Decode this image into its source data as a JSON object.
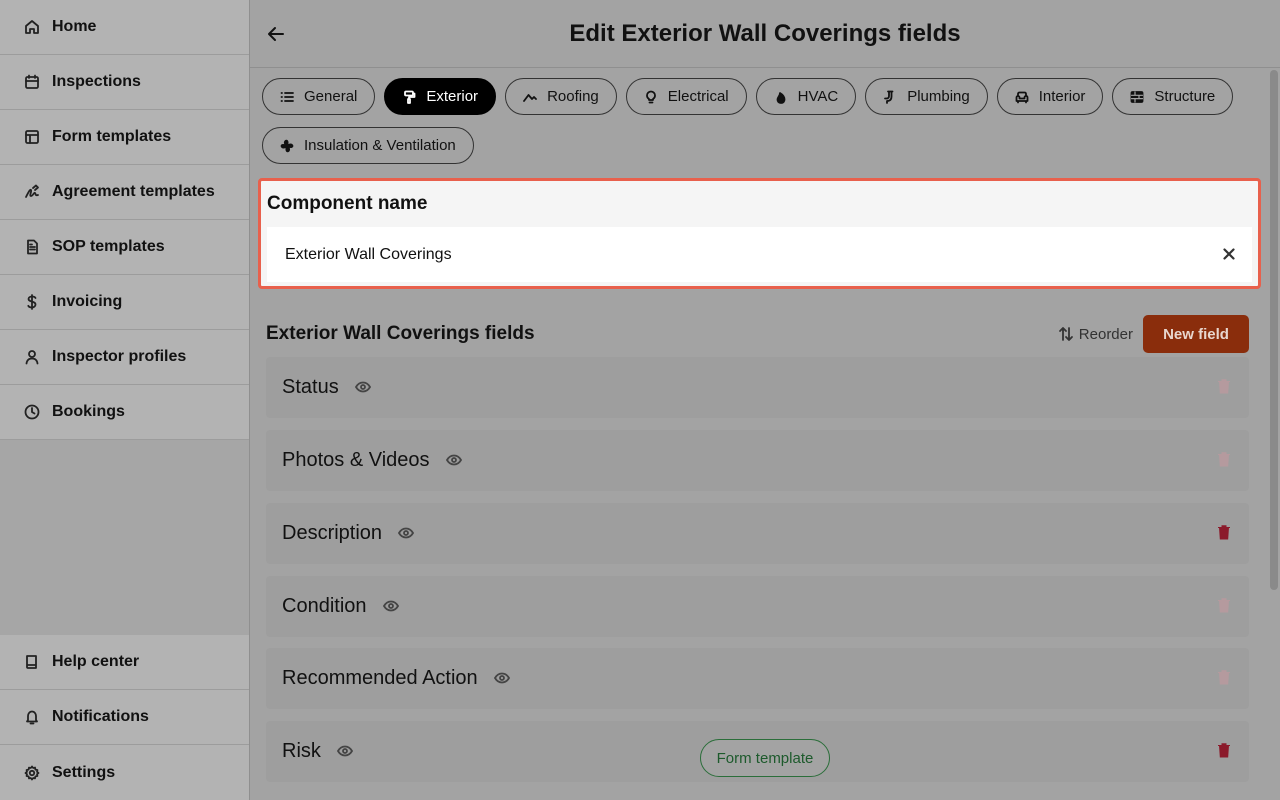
{
  "sidebar": {
    "items": [
      {
        "label": "Home",
        "icon": "home-icon"
      },
      {
        "label": "Inspections",
        "icon": "calendar-icon"
      },
      {
        "label": "Form templates",
        "icon": "layout-icon"
      },
      {
        "label": "Agreement templates",
        "icon": "signature-icon"
      },
      {
        "label": "SOP templates",
        "icon": "document-icon"
      },
      {
        "label": "Invoicing",
        "icon": "dollar-icon"
      },
      {
        "label": "Inspector profiles",
        "icon": "user-icon"
      },
      {
        "label": "Bookings",
        "icon": "clock-icon"
      }
    ],
    "bottom_items": [
      {
        "label": "Help center",
        "icon": "book-icon"
      },
      {
        "label": "Notifications",
        "icon": "bell-icon"
      },
      {
        "label": "Settings",
        "icon": "gear-icon"
      }
    ]
  },
  "header": {
    "title": "Edit Exterior Wall Coverings fields"
  },
  "tabs": [
    {
      "label": "General",
      "icon": "list-icon",
      "active": false
    },
    {
      "label": "Exterior",
      "icon": "paint-roller-icon",
      "active": true
    },
    {
      "label": "Roofing",
      "icon": "roof-icon",
      "active": false
    },
    {
      "label": "Electrical",
      "icon": "lightbulb-icon",
      "active": false
    },
    {
      "label": "HVAC",
      "icon": "flame-icon",
      "active": false
    },
    {
      "label": "Plumbing",
      "icon": "pipe-icon",
      "active": false
    },
    {
      "label": "Interior",
      "icon": "sofa-icon",
      "active": false
    },
    {
      "label": "Structure",
      "icon": "bricks-icon",
      "active": false
    },
    {
      "label": "Insulation & Ventilation",
      "icon": "fan-icon",
      "active": false
    }
  ],
  "component": {
    "label": "Component name",
    "value": "Exterior Wall Coverings"
  },
  "fields_section": {
    "title": "Exterior Wall Coverings fields",
    "reorder_label": "Reorder",
    "new_field_label": "New field"
  },
  "fields": [
    {
      "name": "Status",
      "deletable": false
    },
    {
      "name": "Photos & Videos",
      "deletable": false
    },
    {
      "name": "Description",
      "deletable": true
    },
    {
      "name": "Condition",
      "deletable": false
    },
    {
      "name": "Recommended Action",
      "deletable": false
    },
    {
      "name": "Risk",
      "deletable": true
    }
  ],
  "floating_chip": {
    "label": "Form template"
  },
  "colors": {
    "accent": "#8a2d0c",
    "highlight_border": "#e8604c",
    "trash_active": "#8b1a2b",
    "trash_disabled": "#b59a9e",
    "chip_green": "#2b6e3a"
  }
}
